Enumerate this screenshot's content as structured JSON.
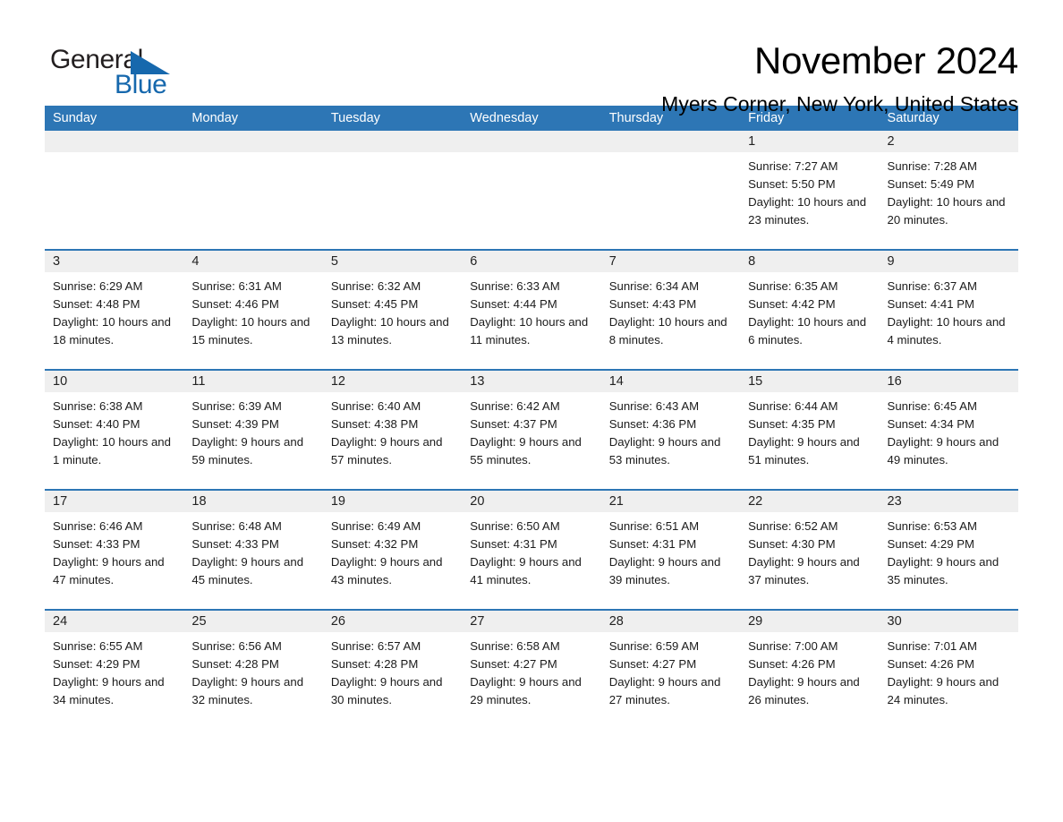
{
  "brand": {
    "name_part1": "General",
    "name_part2": "Blue",
    "accent_color": "#1668ad"
  },
  "header": {
    "month_title": "November 2024",
    "location": "Myers Corner, New York, United States"
  },
  "theme": {
    "header_blue": "#2d76b5",
    "daynum_band": "#efefef",
    "text": "#1b1b1b"
  },
  "calendar": {
    "weekdays": [
      "Sunday",
      "Monday",
      "Tuesday",
      "Wednesday",
      "Thursday",
      "Friday",
      "Saturday"
    ],
    "labels": {
      "sunrise": "Sunrise:",
      "sunset": "Sunset:",
      "daylight": "Daylight:"
    },
    "weeks": [
      [
        {
          "day": "",
          "sunrise": "",
          "sunset": "",
          "daylight": ""
        },
        {
          "day": "",
          "sunrise": "",
          "sunset": "",
          "daylight": ""
        },
        {
          "day": "",
          "sunrise": "",
          "sunset": "",
          "daylight": ""
        },
        {
          "day": "",
          "sunrise": "",
          "sunset": "",
          "daylight": ""
        },
        {
          "day": "",
          "sunrise": "",
          "sunset": "",
          "daylight": ""
        },
        {
          "day": "1",
          "sunrise": "Sunrise: 7:27 AM",
          "sunset": "Sunset: 5:50 PM",
          "daylight": "Daylight: 10 hours and 23 minutes."
        },
        {
          "day": "2",
          "sunrise": "Sunrise: 7:28 AM",
          "sunset": "Sunset: 5:49 PM",
          "daylight": "Daylight: 10 hours and 20 minutes."
        }
      ],
      [
        {
          "day": "3",
          "sunrise": "Sunrise: 6:29 AM",
          "sunset": "Sunset: 4:48 PM",
          "daylight": "Daylight: 10 hours and 18 minutes."
        },
        {
          "day": "4",
          "sunrise": "Sunrise: 6:31 AM",
          "sunset": "Sunset: 4:46 PM",
          "daylight": "Daylight: 10 hours and 15 minutes."
        },
        {
          "day": "5",
          "sunrise": "Sunrise: 6:32 AM",
          "sunset": "Sunset: 4:45 PM",
          "daylight": "Daylight: 10 hours and 13 minutes."
        },
        {
          "day": "6",
          "sunrise": "Sunrise: 6:33 AM",
          "sunset": "Sunset: 4:44 PM",
          "daylight": "Daylight: 10 hours and 11 minutes."
        },
        {
          "day": "7",
          "sunrise": "Sunrise: 6:34 AM",
          "sunset": "Sunset: 4:43 PM",
          "daylight": "Daylight: 10 hours and 8 minutes."
        },
        {
          "day": "8",
          "sunrise": "Sunrise: 6:35 AM",
          "sunset": "Sunset: 4:42 PM",
          "daylight": "Daylight: 10 hours and 6 minutes."
        },
        {
          "day": "9",
          "sunrise": "Sunrise: 6:37 AM",
          "sunset": "Sunset: 4:41 PM",
          "daylight": "Daylight: 10 hours and 4 minutes."
        }
      ],
      [
        {
          "day": "10",
          "sunrise": "Sunrise: 6:38 AM",
          "sunset": "Sunset: 4:40 PM",
          "daylight": "Daylight: 10 hours and 1 minute."
        },
        {
          "day": "11",
          "sunrise": "Sunrise: 6:39 AM",
          "sunset": "Sunset: 4:39 PM",
          "daylight": "Daylight: 9 hours and 59 minutes."
        },
        {
          "day": "12",
          "sunrise": "Sunrise: 6:40 AM",
          "sunset": "Sunset: 4:38 PM",
          "daylight": "Daylight: 9 hours and 57 minutes."
        },
        {
          "day": "13",
          "sunrise": "Sunrise: 6:42 AM",
          "sunset": "Sunset: 4:37 PM",
          "daylight": "Daylight: 9 hours and 55 minutes."
        },
        {
          "day": "14",
          "sunrise": "Sunrise: 6:43 AM",
          "sunset": "Sunset: 4:36 PM",
          "daylight": "Daylight: 9 hours and 53 minutes."
        },
        {
          "day": "15",
          "sunrise": "Sunrise: 6:44 AM",
          "sunset": "Sunset: 4:35 PM",
          "daylight": "Daylight: 9 hours and 51 minutes."
        },
        {
          "day": "16",
          "sunrise": "Sunrise: 6:45 AM",
          "sunset": "Sunset: 4:34 PM",
          "daylight": "Daylight: 9 hours and 49 minutes."
        }
      ],
      [
        {
          "day": "17",
          "sunrise": "Sunrise: 6:46 AM",
          "sunset": "Sunset: 4:33 PM",
          "daylight": "Daylight: 9 hours and 47 minutes."
        },
        {
          "day": "18",
          "sunrise": "Sunrise: 6:48 AM",
          "sunset": "Sunset: 4:33 PM",
          "daylight": "Daylight: 9 hours and 45 minutes."
        },
        {
          "day": "19",
          "sunrise": "Sunrise: 6:49 AM",
          "sunset": "Sunset: 4:32 PM",
          "daylight": "Daylight: 9 hours and 43 minutes."
        },
        {
          "day": "20",
          "sunrise": "Sunrise: 6:50 AM",
          "sunset": "Sunset: 4:31 PM",
          "daylight": "Daylight: 9 hours and 41 minutes."
        },
        {
          "day": "21",
          "sunrise": "Sunrise: 6:51 AM",
          "sunset": "Sunset: 4:31 PM",
          "daylight": "Daylight: 9 hours and 39 minutes."
        },
        {
          "day": "22",
          "sunrise": "Sunrise: 6:52 AM",
          "sunset": "Sunset: 4:30 PM",
          "daylight": "Daylight: 9 hours and 37 minutes."
        },
        {
          "day": "23",
          "sunrise": "Sunrise: 6:53 AM",
          "sunset": "Sunset: 4:29 PM",
          "daylight": "Daylight: 9 hours and 35 minutes."
        }
      ],
      [
        {
          "day": "24",
          "sunrise": "Sunrise: 6:55 AM",
          "sunset": "Sunset: 4:29 PM",
          "daylight": "Daylight: 9 hours and 34 minutes."
        },
        {
          "day": "25",
          "sunrise": "Sunrise: 6:56 AM",
          "sunset": "Sunset: 4:28 PM",
          "daylight": "Daylight: 9 hours and 32 minutes."
        },
        {
          "day": "26",
          "sunrise": "Sunrise: 6:57 AM",
          "sunset": "Sunset: 4:28 PM",
          "daylight": "Daylight: 9 hours and 30 minutes."
        },
        {
          "day": "27",
          "sunrise": "Sunrise: 6:58 AM",
          "sunset": "Sunset: 4:27 PM",
          "daylight": "Daylight: 9 hours and 29 minutes."
        },
        {
          "day": "28",
          "sunrise": "Sunrise: 6:59 AM",
          "sunset": "Sunset: 4:27 PM",
          "daylight": "Daylight: 9 hours and 27 minutes."
        },
        {
          "day": "29",
          "sunrise": "Sunrise: 7:00 AM",
          "sunset": "Sunset: 4:26 PM",
          "daylight": "Daylight: 9 hours and 26 minutes."
        },
        {
          "day": "30",
          "sunrise": "Sunrise: 7:01 AM",
          "sunset": "Sunset: 4:26 PM",
          "daylight": "Daylight: 9 hours and 24 minutes."
        }
      ]
    ]
  }
}
